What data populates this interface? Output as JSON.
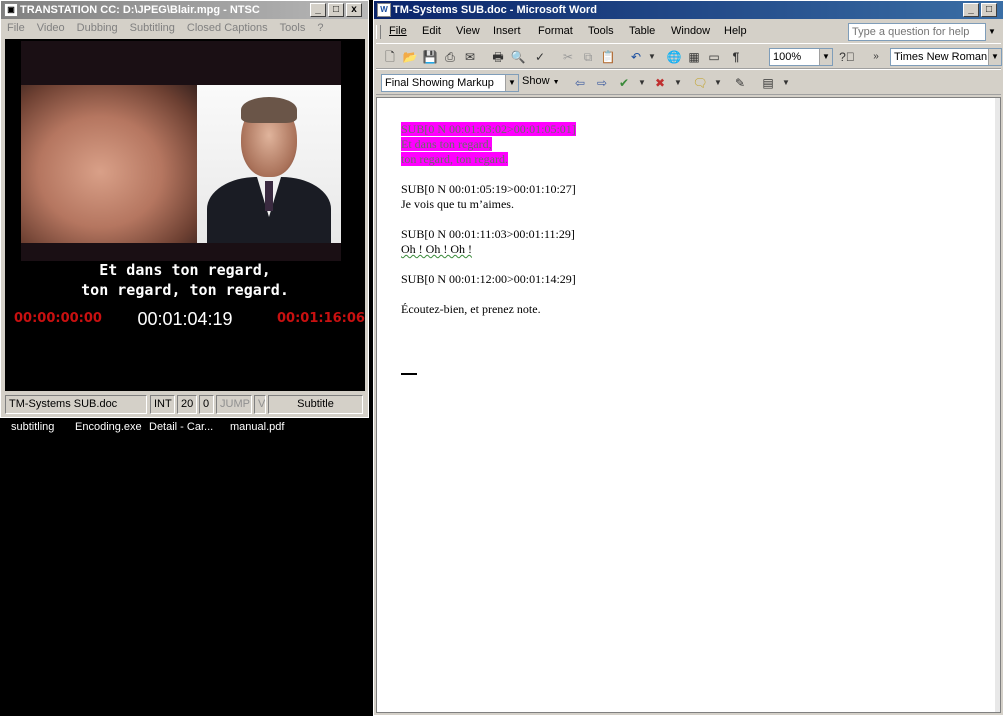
{
  "left_window": {
    "title": "TRANSTATION CC: D:\\JPEG\\Blair.mpg - NTSC",
    "controls": [
      "_",
      "□",
      "x"
    ],
    "menu": [
      "File",
      "Video",
      "Dubbing",
      "Subtitling",
      "Closed Captions",
      "Tools",
      "?"
    ],
    "subtitle_lines": [
      "Et dans ton regard,",
      "ton regard, ton regard."
    ],
    "timecode_in": "00:00:00:00",
    "timecode_current": "00:01:04:19",
    "timecode_out": "00:01:16:06",
    "status": {
      "file": "TM-Systems SUB.doc",
      "mode": "INT",
      "n1": "20",
      "n2": "0",
      "jump": "JUMP",
      "v": "V",
      "type": "Subtitle"
    }
  },
  "desktop_labels": [
    "subtitling",
    "Encoding.exe",
    "Detail - Car...",
    "manual.pdf"
  ],
  "right_window": {
    "title": "TM-Systems SUB.doc - Microsoft Word",
    "menu": [
      "File",
      "Edit",
      "View",
      "Insert",
      "Format",
      "Tools",
      "Table",
      "Window",
      "Help"
    ],
    "help_placeholder": "Type a question for help",
    "zoom": "100%",
    "font": "Times New Roman",
    "markup_mode": "Final Showing Markup",
    "show_label": "Show",
    "document": {
      "blocks": [
        {
          "header": "SUB[0 N 00:01:03:02>00:01:05:01]",
          "lines": [
            "Et dans ton regard,",
            "ton regard, ton regard."
          ],
          "highlighted": true
        },
        {
          "header": "SUB[0 N 00:01:05:19>00:01:10:27]",
          "lines": [
            "Je vois  que tu m’aimes."
          ],
          "highlighted": false
        },
        {
          "header": "SUB[0 N 00:01:11:03>00:01:11:29]",
          "lines": [
            "Oh ! Oh ! Oh !"
          ],
          "highlighted": false
        },
        {
          "header": "SUB[0 N 00:01:12:00>00:01:14:29]",
          "lines": [],
          "highlighted": false
        }
      ],
      "trailing_line": "Écoutez-bien, et prenez note."
    }
  },
  "colors": {
    "highlight": "#ff00ff",
    "timecode_red": "#c81010",
    "active_title": "#0a246a"
  }
}
